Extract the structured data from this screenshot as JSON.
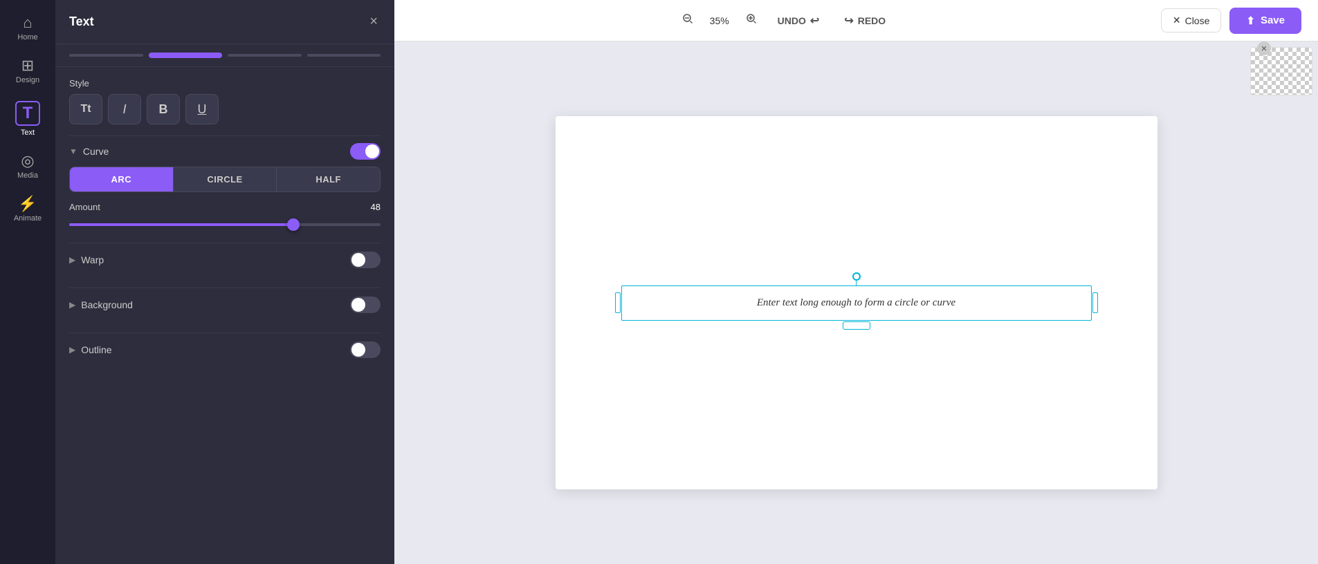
{
  "nav": {
    "items": [
      {
        "id": "home",
        "icon": "⌂",
        "label": "Home"
      },
      {
        "id": "design",
        "icon": "⊞",
        "label": "Design"
      },
      {
        "id": "text",
        "icon": "T",
        "label": "Text",
        "active": true
      },
      {
        "id": "media",
        "icon": "◎",
        "label": "Media"
      },
      {
        "id": "animate",
        "icon": "⚡",
        "label": "Animate"
      }
    ]
  },
  "panel": {
    "title": "Text",
    "close_label": "×",
    "tabs": [
      {
        "id": "t1",
        "active": false
      },
      {
        "id": "t2",
        "active": true
      },
      {
        "id": "t3",
        "active": false
      },
      {
        "id": "t4",
        "active": false
      }
    ],
    "style": {
      "label": "Style",
      "buttons": [
        {
          "id": "font",
          "icon": "Tt"
        },
        {
          "id": "italic",
          "icon": "I"
        },
        {
          "id": "bold",
          "icon": "B"
        },
        {
          "id": "underline",
          "icon": "U"
        }
      ]
    },
    "curve": {
      "label": "Curve",
      "enabled": true,
      "types": [
        {
          "id": "arc",
          "label": "ARC",
          "active": true
        },
        {
          "id": "circle",
          "label": "CIRCLE",
          "active": false
        },
        {
          "id": "half",
          "label": "HALF",
          "active": false
        }
      ],
      "amount": {
        "label": "Amount",
        "value": 48,
        "min": 0,
        "max": 100,
        "percent": 72
      }
    },
    "warp": {
      "label": "Warp",
      "enabled": false
    },
    "background": {
      "label": "Background",
      "enabled": false
    },
    "outline": {
      "label": "Outline",
      "enabled": false
    }
  },
  "toolbar": {
    "zoom_value": "35%",
    "zoom_in_label": "+",
    "zoom_out_label": "−",
    "undo_label": "UNDO",
    "redo_label": "REDO",
    "close_label": "Close",
    "save_label": "Save"
  },
  "canvas": {
    "text_placeholder": "Enter text long enough to form a circle or curve"
  }
}
